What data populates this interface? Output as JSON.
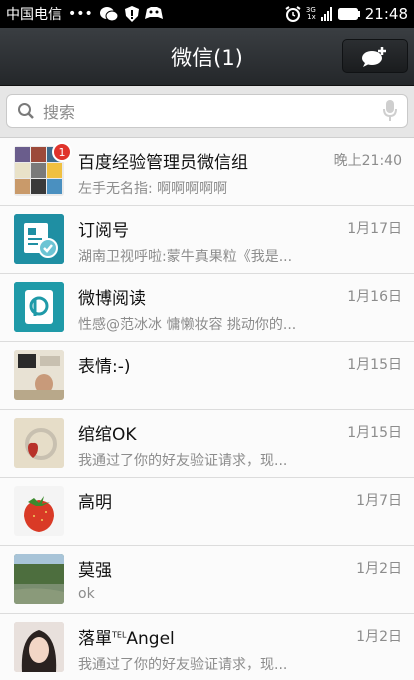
{
  "status_bar": {
    "carrier": "中国电信",
    "dots": "•••",
    "network_top": "3G",
    "network_bottom": "1x",
    "time": "21:48"
  },
  "header": {
    "title": "微信(1)"
  },
  "search": {
    "placeholder": "搜索"
  },
  "chats": [
    {
      "name": "百度经验管理员微信组",
      "preview": "左手无名指: 啊啊啊啊啊",
      "time": "晚上21:40",
      "badge": "1"
    },
    {
      "name": "订阅号",
      "preview": "湖南卫视呼啦:蒙牛真果粒《我是...",
      "time": "1月17日"
    },
    {
      "name": "微博阅读",
      "preview": "性感@范冰冰 慵懒妆容 挑动你的...",
      "time": "1月16日"
    },
    {
      "name": "表情:-)",
      "preview": "",
      "time": "1月15日"
    },
    {
      "name": "绾绾OK",
      "preview": "我通过了你的好友验证请求，现...",
      "time": "1月15日"
    },
    {
      "name": "高明",
      "preview": "",
      "time": "1月7日"
    },
    {
      "name": "莫强",
      "preview": "ok",
      "time": "1月2日"
    },
    {
      "name": "落單",
      "name_sup": "TEL",
      "name_suffix": "Angel",
      "preview": "我通过了你的好友验证请求，现...",
      "time": "1月2日"
    }
  ],
  "colors": {
    "badge": "#e0332b",
    "header_bg": "#2d3033",
    "accent_teal": "#1f8fa3"
  }
}
